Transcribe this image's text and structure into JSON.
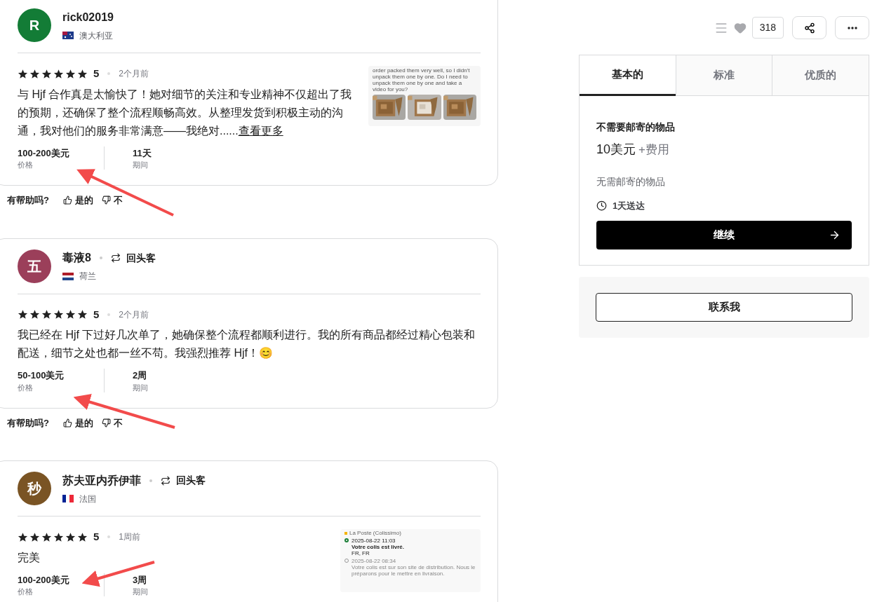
{
  "toolbar": {
    "like_count": "318"
  },
  "reviews": [
    {
      "avatar": {
        "letter": "R",
        "color": "#137c36"
      },
      "name": "rick02019",
      "flag": {
        "kind": "au"
      },
      "country": "澳大利亚",
      "stars": 6,
      "rating": "5",
      "time": "2个月前",
      "text": "与 Hjf 合作真是太愉快了！她对细节的关注和专业精神不仅超出了我的预期，还确保了整个流程顺畅高效。从整理发货到积极主动的沟通，我对他们的服务非常满意——我绝对......",
      "more_link": "查看更多",
      "stats": [
        {
          "value": "100-200美元",
          "label": "价格"
        },
        {
          "value": "11天",
          "label": "期间"
        }
      ],
      "attachment": {
        "kind": "chat",
        "text": "order packed them very well, so I didn't unpack them one by one. Do I need to unpack them one by one and take a video for you?"
      },
      "helpful": {
        "question": "有帮助吗?",
        "yes": "是的",
        "no": "不"
      }
    },
    {
      "avatar": {
        "letter": "五",
        "color": "#9b3f5a"
      },
      "name": "毒液8",
      "badge": "回头客",
      "flag": {
        "kind": "nl"
      },
      "country": "荷兰",
      "stars": 6,
      "rating": "5",
      "time": "2个月前",
      "text": "我已经在 Hjf 下过好几次单了，她确保整个流程都顺利进行。我的所有商品都经过精心包装和配送，细节之处也都一丝不苟。我强烈推荐 Hjf！😊",
      "stats": [
        {
          "value": "50-100美元",
          "label": "价格"
        },
        {
          "value": "2周",
          "label": "期间"
        }
      ],
      "helpful": {
        "question": "有帮助吗?",
        "yes": "是的",
        "no": "不"
      }
    },
    {
      "avatar": {
        "letter": "秒",
        "color": "#7a5424"
      },
      "name": "苏夫亚内乔伊菲",
      "badge": "回头客",
      "flag": {
        "kind": "fr"
      },
      "country": "法国",
      "stars": 6,
      "rating": "5",
      "time": "1周前",
      "text": "完美",
      "stats": [
        {
          "value": "100-200美元",
          "label": "价格"
        },
        {
          "value": "3周",
          "label": "期间"
        }
      ],
      "attachment": {
        "kind": "tracking",
        "carrier": "La Poste (Colissimo)",
        "events": [
          {
            "time": "2025-08-22 11:03",
            "title": "Votre colis est livré.",
            "detail": "FR, FR",
            "done": true
          },
          {
            "time": "2025-08-22 08:34",
            "title": "Votre colis est sur son site de distribution. Nous le préparons pour le mettre en livraison.",
            "done": false
          }
        ]
      }
    }
  ],
  "package_tabs": [
    {
      "label": "基本的",
      "selected": true
    },
    {
      "label": "标准",
      "selected": false
    },
    {
      "label": "优质的",
      "selected": false
    }
  ],
  "package": {
    "title": "不需要邮寄的物品",
    "price": "10美元",
    "fee": "+费用",
    "description": "无需邮寄的物品",
    "delivery": "1天送达",
    "continue_button": "继续"
  },
  "contact_button": "联系我"
}
